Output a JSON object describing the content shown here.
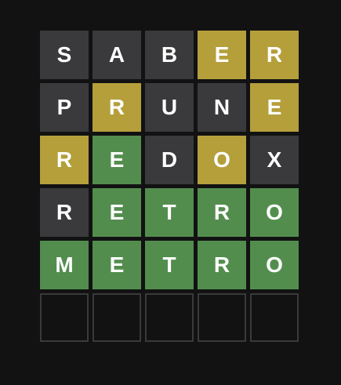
{
  "board": {
    "rows": [
      [
        {
          "letter": "S",
          "state": "absent"
        },
        {
          "letter": "A",
          "state": "absent"
        },
        {
          "letter": "B",
          "state": "absent"
        },
        {
          "letter": "E",
          "state": "present"
        },
        {
          "letter": "R",
          "state": "present"
        }
      ],
      [
        {
          "letter": "P",
          "state": "absent"
        },
        {
          "letter": "R",
          "state": "present"
        },
        {
          "letter": "U",
          "state": "absent"
        },
        {
          "letter": "N",
          "state": "absent"
        },
        {
          "letter": "E",
          "state": "present"
        }
      ],
      [
        {
          "letter": "R",
          "state": "present"
        },
        {
          "letter": "E",
          "state": "correct"
        },
        {
          "letter": "D",
          "state": "absent"
        },
        {
          "letter": "O",
          "state": "present"
        },
        {
          "letter": "X",
          "state": "absent"
        }
      ],
      [
        {
          "letter": "R",
          "state": "absent"
        },
        {
          "letter": "E",
          "state": "correct"
        },
        {
          "letter": "T",
          "state": "correct"
        },
        {
          "letter": "R",
          "state": "correct"
        },
        {
          "letter": "O",
          "state": "correct"
        }
      ],
      [
        {
          "letter": "M",
          "state": "correct"
        },
        {
          "letter": "E",
          "state": "correct"
        },
        {
          "letter": "T",
          "state": "correct"
        },
        {
          "letter": "R",
          "state": "correct"
        },
        {
          "letter": "O",
          "state": "correct"
        }
      ],
      [
        {
          "letter": "",
          "state": "empty"
        },
        {
          "letter": "",
          "state": "empty"
        },
        {
          "letter": "",
          "state": "empty"
        },
        {
          "letter": "",
          "state": "empty"
        },
        {
          "letter": "",
          "state": "empty"
        }
      ]
    ]
  },
  "colors": {
    "background": "#121213",
    "absent": "#3a3a3c",
    "present": "#b59f3b",
    "correct": "#538d4e",
    "empty_border": "#3a3a3c",
    "letter": "#ffffff"
  }
}
